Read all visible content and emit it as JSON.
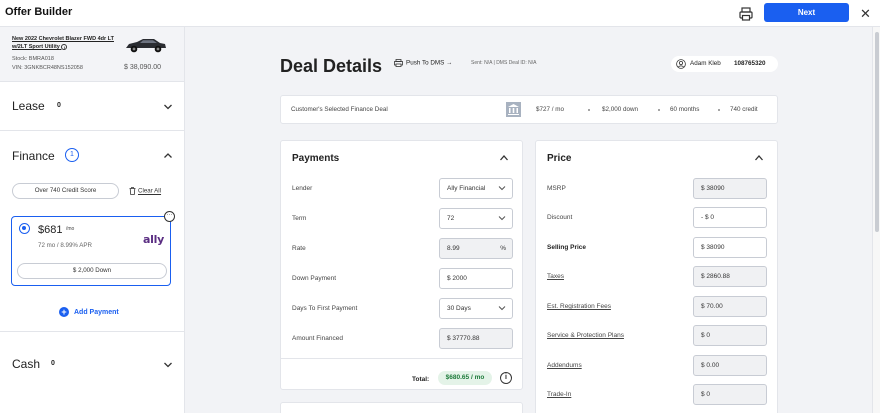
{
  "app": {
    "title": "Offer Builder",
    "next_label": "Next",
    "close_glyph": "✕"
  },
  "vehicle": {
    "title": "New 2022 Chevrolet Blazer FWD 4dr LT w/2LT Sport Utility",
    "stock": "Stock: BMRA018",
    "vin": "VIN: 3GNKBCR48NS152058",
    "price": "$ 38,090.00"
  },
  "sidebar": {
    "lease": {
      "label": "Lease",
      "count": "0"
    },
    "finance": {
      "label": "Finance",
      "count": "1",
      "credit_chip": "Over 740 Credit Score",
      "clear_all": "Clear All",
      "deal": {
        "payment": "$681",
        "payment_unit": "/mo",
        "sub": "72 mo / 8.99% APR",
        "lender_logo": "ally",
        "down": "$ 2,000 Down",
        "more_glyph": "···"
      },
      "add_payment": "Add Payment"
    },
    "cash": {
      "label": "Cash",
      "count": "0"
    }
  },
  "header": {
    "title": "Deal Details",
    "push_dms": "Push To DMS →",
    "dms_status": "Sent: N/A  |  DMS Deal ID: N/A",
    "user_name": "Adam Kleb",
    "user_id": "108765320"
  },
  "selected_deal": {
    "label": "Customer's Selected Finance Deal",
    "stats": [
      "$727 / mo",
      "$2,000 down",
      "60 months",
      "740 credit"
    ]
  },
  "payments": {
    "title": "Payments",
    "rows": [
      {
        "label": "Lender",
        "value": "Ally Financial",
        "kind": "select"
      },
      {
        "label": "Term",
        "value": "72",
        "kind": "select"
      },
      {
        "label": "Rate",
        "value": "8.99",
        "suffix": "%",
        "kind": "readonly"
      },
      {
        "label": "Down Payment",
        "value": "$  2000",
        "kind": "input"
      },
      {
        "label": "Days To First Payment",
        "value": "30 Days",
        "kind": "select"
      },
      {
        "label": "Amount Financed",
        "value": "$  37770.88",
        "kind": "readonly"
      }
    ],
    "total_label": "Total:",
    "total_value": "$680.65 / mo",
    "info_glyph": "i"
  },
  "price": {
    "title": "Price",
    "rows": [
      {
        "label": "MSRP",
        "value": "$  38090",
        "kind": "readonly",
        "style": "plain"
      },
      {
        "label": "Discount",
        "value": "- $  0",
        "kind": "input",
        "style": "plain"
      },
      {
        "label": "Selling Price",
        "value": "$  38090",
        "kind": "input",
        "style": "bold"
      },
      {
        "label": "Taxes",
        "value": "$  2860.88",
        "kind": "readonly",
        "style": "link"
      },
      {
        "label": "Est. Registration Fees",
        "value": "$  70.00",
        "kind": "readonly",
        "style": "link"
      },
      {
        "label": "Service & Protection Plans",
        "value": "$  0",
        "kind": "readonly",
        "style": "link"
      },
      {
        "label": "Addendums",
        "value": "$  0.00",
        "kind": "readonly",
        "style": "link"
      },
      {
        "label": "Trade-In",
        "value": "$  0",
        "kind": "readonly",
        "style": "link"
      }
    ]
  },
  "colors": {
    "accent": "#1a5ff0",
    "total_green": "#1d7a3a",
    "ally_purple": "#5a2d82"
  }
}
